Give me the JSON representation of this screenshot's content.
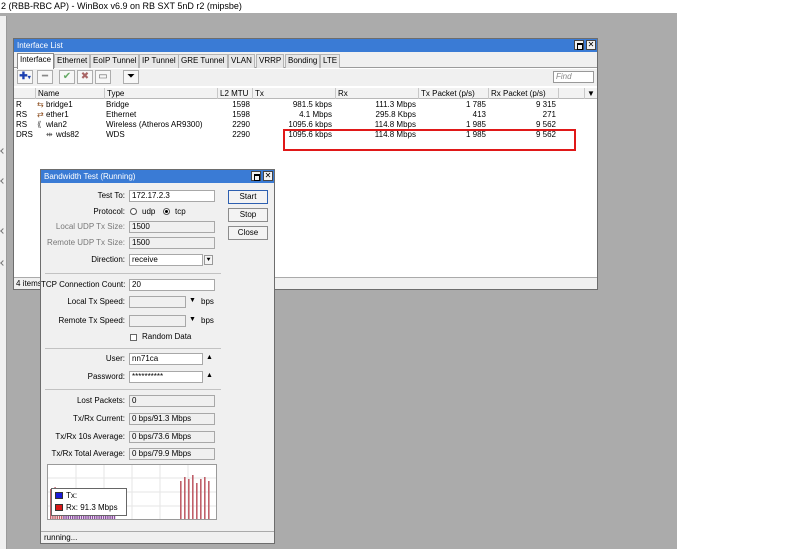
{
  "main_window": {
    "title": "2 (RBB-RBC AP) - WinBox v6.9 on RB SXT 5nD r2 (mipsbe)"
  },
  "interface_list": {
    "title": "Interface List",
    "tabs": [
      "Interface",
      "Ethernet",
      "EoIP Tunnel",
      "IP Tunnel",
      "GRE Tunnel",
      "VLAN",
      "VRRP",
      "Bonding",
      "LTE"
    ],
    "active_tab": "Interface",
    "find_placeholder": "Find",
    "columns": [
      "Name",
      "Type",
      "L2 MTU",
      "Tx",
      "Rx",
      "Tx Packet (p/s)",
      "Rx Packet (p/s)"
    ],
    "rows": [
      {
        "flags": "R",
        "icon": "bridge-icon",
        "name": "bridge1",
        "type": "Bridge",
        "l2mtu": "1598",
        "tx": "981.5 kbps",
        "rx": "111.3 Mbps",
        "tx_pps": "1 785",
        "rx_pps": "9 315"
      },
      {
        "flags": "RS",
        "icon": "ethernet-icon",
        "name": "ether1",
        "type": "Ethernet",
        "l2mtu": "1598",
        "tx": "4.1 Mbps",
        "rx": "295.8 Kbps",
        "tx_pps": "413",
        "rx_pps": "271"
      },
      {
        "flags": "RS",
        "icon": "wireless-icon",
        "name": "wlan2",
        "type": "Wireless (Atheros AR9300)",
        "l2mtu": "2290",
        "tx": "1095.6 kbps",
        "rx": "114.8 Mbps",
        "tx_pps": "1 985",
        "rx_pps": "9 562"
      },
      {
        "flags": "DRS",
        "icon": "wds-icon",
        "name": "wds82",
        "type": "WDS",
        "l2mtu": "2290",
        "tx": "1095.6 kbps",
        "rx": "114.8 Mbps",
        "tx_pps": "1 985",
        "rx_pps": "9 562"
      }
    ],
    "status": "4 items",
    "highlight_color": "#e01818"
  },
  "bandwidth_test": {
    "title": "Bandwidth Test (Running)",
    "buttons": {
      "start": "Start",
      "stop": "Stop",
      "close": "Close"
    },
    "test_to": {
      "label": "Test To:",
      "value": "172.17.2.3"
    },
    "protocol": {
      "label": "Protocol:",
      "options": [
        "udp",
        "tcp"
      ],
      "selected": "tcp"
    },
    "local_udp_tx_size": {
      "label": "Local UDP Tx Size:",
      "value": "1500"
    },
    "remote_udp_tx_size": {
      "label": "Remote UDP Tx Size:",
      "value": "1500"
    },
    "direction": {
      "label": "Direction:",
      "value": "receive"
    },
    "tcp_connection_count": {
      "label": "TCP Connection Count:",
      "value": "20"
    },
    "local_tx_speed": {
      "label": "Local Tx Speed:",
      "value": "",
      "unit": "bps"
    },
    "remote_tx_speed": {
      "label": "Remote Tx Speed:",
      "value": "",
      "unit": "bps"
    },
    "random_data": {
      "label": "Random Data",
      "checked": false
    },
    "user": {
      "label": "User:",
      "value": "nn71ca"
    },
    "password": {
      "label": "Password:",
      "value": "**********"
    },
    "lost_packets": {
      "label": "Lost Packets:",
      "value": "0"
    },
    "txrx_current": {
      "label": "Tx/Rx Current:",
      "value": "0 bps/91.3 Mbps"
    },
    "txrx_10s_average": {
      "label": "Tx/Rx 10s Average:",
      "value": "0 bps/73.6 Mbps"
    },
    "txrx_total_average": {
      "label": "Tx/Rx Total Average:",
      "value": "0 bps/79.9 Mbps"
    },
    "graph": {
      "legend_tx": "Tx:",
      "legend_rx": "Rx:  91.3 Mbps",
      "tx_color": "#1a1ad8",
      "rx_color": "#d81818"
    },
    "status": "running..."
  }
}
